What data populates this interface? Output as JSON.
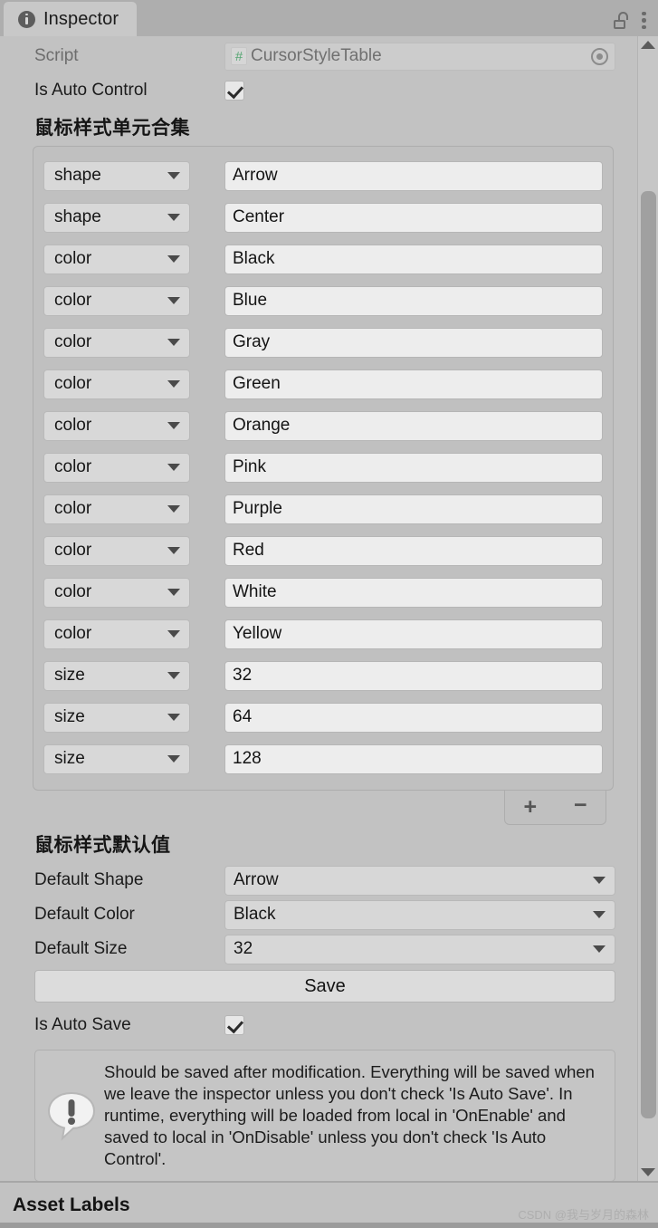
{
  "window": {
    "tab_label": "Inspector",
    "tab_icon": "info-circle-icon",
    "lock_icon": "unlocked-padlock-icon",
    "menu_icon": "kebab-menu-icon"
  },
  "script_row": {
    "label": "Script",
    "icon": "csharp-script-icon",
    "icon_glyph": "#",
    "value": "CursorStyleTable",
    "picker_icon": "object-picker-icon"
  },
  "auto_control_row": {
    "label": "Is Auto Control",
    "checked": true
  },
  "list_section": {
    "title": "鼠标样式单元合集",
    "rows": [
      {
        "type": "shape",
        "value": "Arrow"
      },
      {
        "type": "shape",
        "value": "Center"
      },
      {
        "type": "color",
        "value": "Black"
      },
      {
        "type": "color",
        "value": "Blue"
      },
      {
        "type": "color",
        "value": "Gray"
      },
      {
        "type": "color",
        "value": "Green"
      },
      {
        "type": "color",
        "value": "Orange"
      },
      {
        "type": "color",
        "value": "Pink"
      },
      {
        "type": "color",
        "value": "Purple"
      },
      {
        "type": "color",
        "value": "Red"
      },
      {
        "type": "color",
        "value": "White"
      },
      {
        "type": "color",
        "value": "Yellow"
      },
      {
        "type": "size",
        "value": "32"
      },
      {
        "type": "size",
        "value": "64"
      },
      {
        "type": "size",
        "value": "128"
      }
    ],
    "add_label": "+",
    "remove_label": "−"
  },
  "defaults_section": {
    "title": "鼠标样式默认值",
    "fields": [
      {
        "label": "Default Shape",
        "value": "Arrow"
      },
      {
        "label": "Default Color",
        "value": "Black"
      },
      {
        "label": "Default Size",
        "value": "32"
      }
    ],
    "save_label": "Save",
    "auto_save_label": "Is Auto Save",
    "auto_save_checked": true
  },
  "help_box": {
    "icon": "exclamation-speech-bubble-icon",
    "text": "Should be saved after modification. Everything will be saved when we leave the inspector unless you don't check 'Is Auto Save'. In runtime, everything will be loaded from local in 'OnEnable' and saved to local in 'OnDisable' unless you don't check 'Is Auto Control'."
  },
  "footer": {
    "title": "Asset Labels",
    "watermark": "CSDN @我与岁月的森林"
  },
  "colors": {
    "panel_bg": "#c2c2c2",
    "tabbar_bg": "#aeaeae",
    "field_bg": "#ededed",
    "dropdown_bg": "#d8d8d8",
    "csharp_accent": "#57a773"
  }
}
